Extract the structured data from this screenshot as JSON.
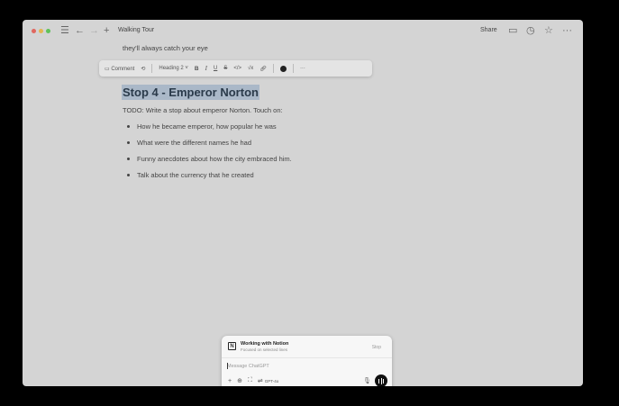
{
  "titlebar": {
    "page_title": "Walking Tour",
    "share_label": "Share",
    "icons": [
      "menu-icon",
      "back-arrow-icon",
      "forward-arrow-icon",
      "plus-icon",
      "comment-icon",
      "clock-icon",
      "star-icon",
      "more-icon"
    ]
  },
  "document": {
    "previous_line": "they'll always catch your eye",
    "heading": "Stop 4 - Emperor Norton",
    "todo": "TODO: Write a stop about emperor Norton. Touch on:",
    "bullets": [
      "How he became emperor, how popular he was",
      "What were the different names he had",
      "Funny anecdotes about how the city embraced him.",
      "Talk about the currency that he created"
    ]
  },
  "toolbar": {
    "comment_label": "Comment",
    "heading_label": "Heading 2",
    "bold": "B",
    "italic": "I",
    "underline": "U",
    "strike": "S",
    "code": "</>",
    "math": "√x",
    "more": "···",
    "text_color": "#222222"
  },
  "chat": {
    "title": "Working with Notion",
    "subtitle": "Focused on selected lines",
    "stop_label": "Stop",
    "input_placeholder": "Message ChatGPT",
    "model_label": "GPT-4o"
  }
}
